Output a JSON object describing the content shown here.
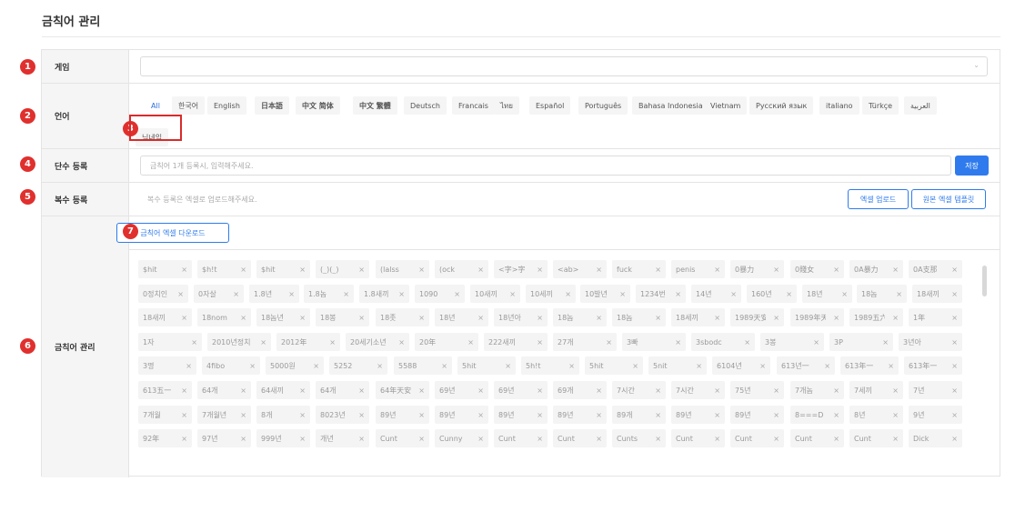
{
  "page": {
    "title": "금칙어 관리"
  },
  "markers": [
    "1",
    "2",
    "3",
    "4",
    "5",
    "6",
    "7"
  ],
  "game": {
    "label": "게임",
    "value": ""
  },
  "language": {
    "label": "언어",
    "tabs": [
      "All",
      "한국어",
      "English",
      "日本語",
      "中文 简体",
      "中文 繁體",
      "Deutsch",
      "Francais",
      "ไทย",
      "Español",
      "Português",
      "Bahasa Indonesia",
      "Vietnam",
      "Русский язык",
      "italiano",
      "Türkçe",
      "العربية",
      "닉네임"
    ],
    "active_tab": "All"
  },
  "single": {
    "label": "단수 등록",
    "placeholder": "금칙어 1개 등록시, 입력해주세요.",
    "save_label": "저장"
  },
  "multi": {
    "label": "복수 등록",
    "hint": "복수 등록은 엑셀로 업로드해주세요.",
    "upload_label": "엑셀 업로드",
    "template_label": "원본 엑셀 템플릿"
  },
  "manage": {
    "label": "금칙어 관리",
    "download_label": "금칙어 엑셀 다운로드",
    "remove_glyph": "×",
    "words": [
      [
        "$hit",
        "$h!t",
        "$hit",
        "(_)(_)",
        "(lalss",
        "(ock",
        "<字>字",
        "<ab>",
        "fuck",
        "penis",
        "0暴力",
        "0賤女",
        "0A暴力",
        "0A支那"
      ],
      [
        "0정치인",
        "0자살",
        "1.8년",
        "1.8놈",
        "1.8새끼",
        "1090",
        "10새끼",
        "10세끼",
        "10발년",
        "1234번",
        "14년",
        "160년",
        "18년",
        "18놈",
        "18새끼"
      ],
      [
        "18새끼",
        "18nom",
        "18놈년",
        "18봉",
        "18좃",
        "18년",
        "18년아",
        "18놈",
        "18놈",
        "18세끼",
        "1989天安門",
        "1989年天安",
        "1989五六四事件",
        "1年"
      ],
      [
        "1자",
        "2010년정치",
        "2012年",
        "20세기소년",
        "20年",
        "222새끼",
        "27개",
        "3빠",
        "3sbodc",
        "3봉",
        "3P",
        "3년아"
      ],
      [
        "3명",
        "4fibo",
        "5000원",
        "5252",
        "5588",
        "5hit",
        "5h!t",
        "5hit",
        "5nit",
        "6104년",
        "613년一",
        "613年一",
        "613年一"
      ],
      [
        "613五一",
        "64개",
        "64새끼",
        "64개",
        "64年天安門",
        "69년",
        "69년",
        "69개",
        "7시간",
        "7시간",
        "75년",
        "7개놈",
        "7세끼",
        "7년"
      ],
      [
        "7개월",
        "7개월년",
        "8개",
        "8023년",
        "89년",
        "89년",
        "89년",
        "89년",
        "89개",
        "89년",
        "89년",
        "8===D",
        "8년",
        "9년"
      ],
      [
        "92年",
        "97년",
        "999년",
        "개년",
        "Cunt",
        "Cunny",
        "Cunt",
        "Cunt",
        "Cunts",
        "Cunt",
        "Cunt",
        "Cunt",
        "Cunt",
        "Dick"
      ]
    ]
  }
}
